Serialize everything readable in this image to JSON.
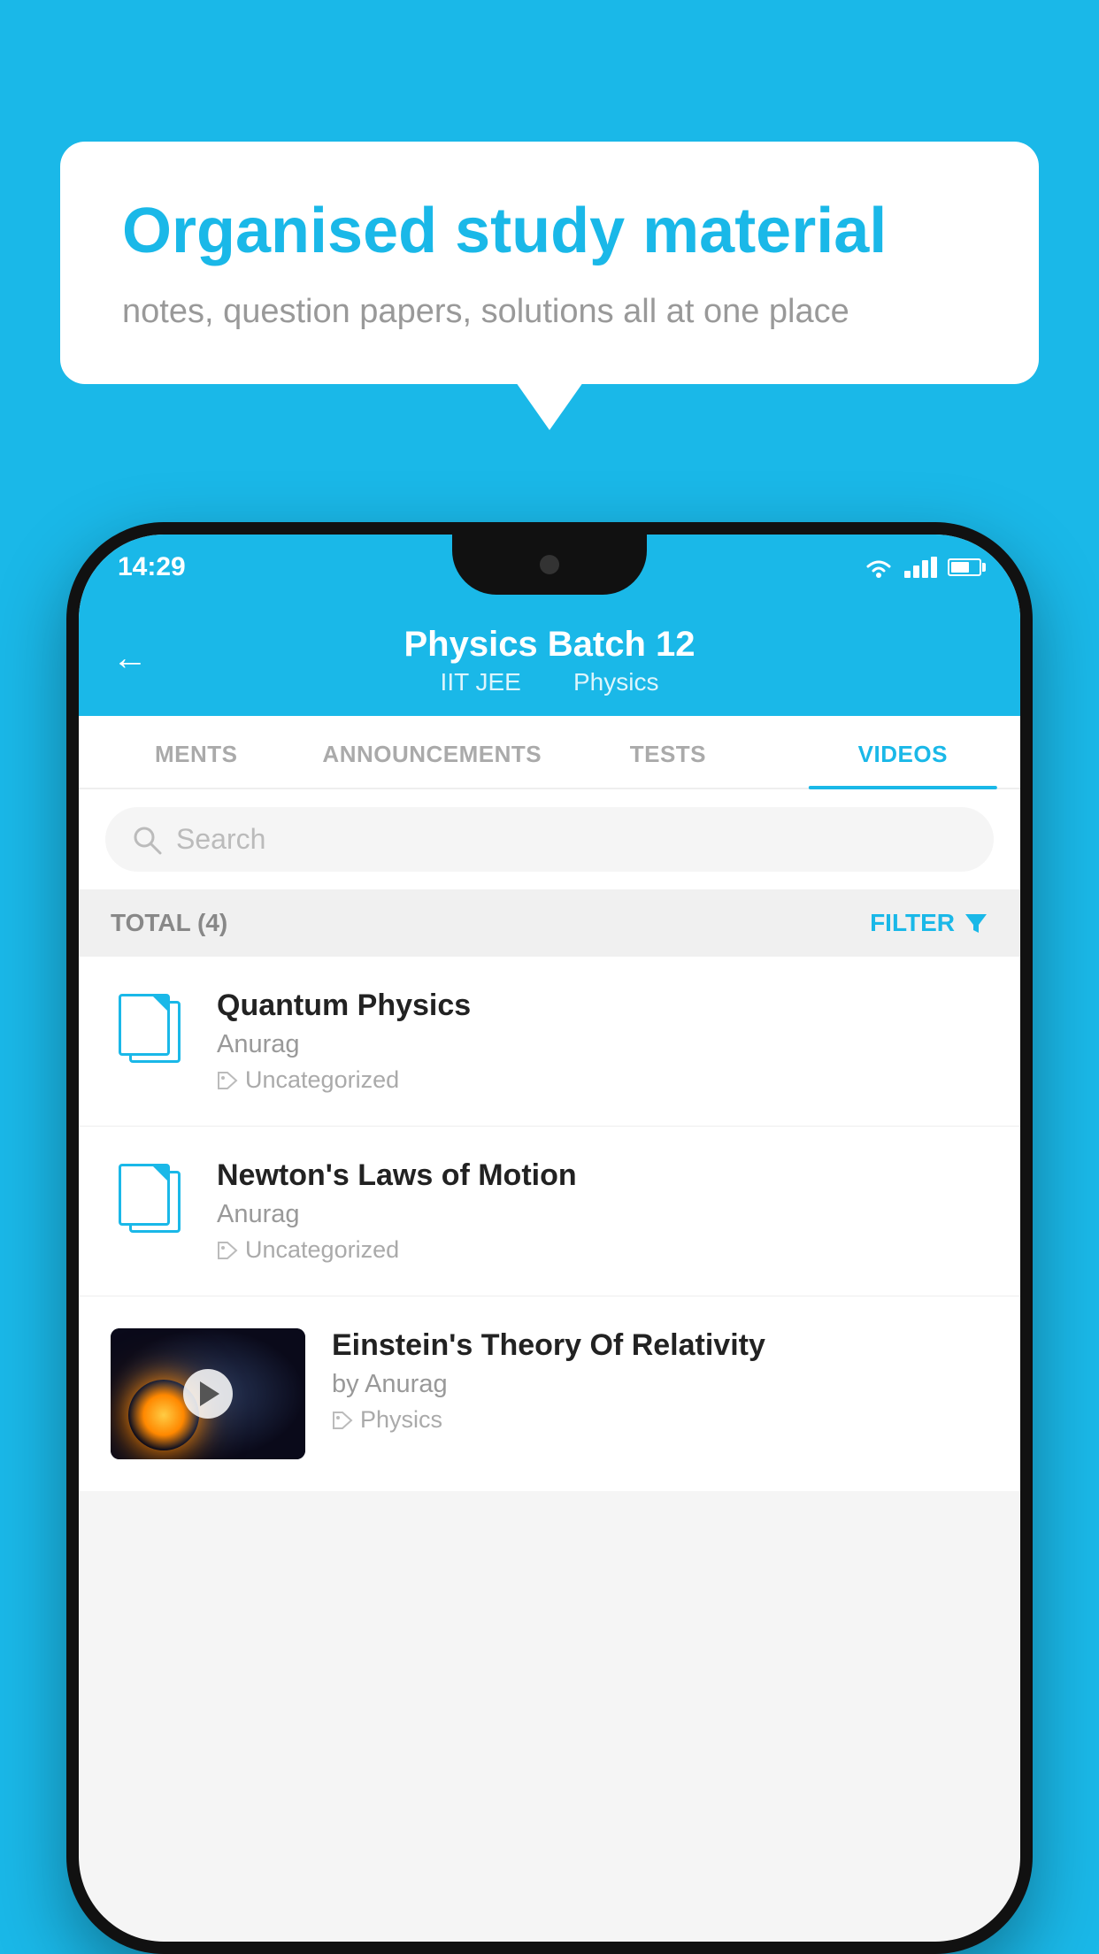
{
  "page": {
    "bg_color": "#1ab8e8"
  },
  "speech_bubble": {
    "title": "Organised study material",
    "subtitle": "notes, question papers, solutions all at one place"
  },
  "status_bar": {
    "time": "14:29"
  },
  "app_header": {
    "title": "Physics Batch 12",
    "tag1": "IIT JEE",
    "tag2": "Physics",
    "back_label": "←"
  },
  "tabs": [
    {
      "label": "MENTS",
      "active": false
    },
    {
      "label": "ANNOUNCEMENTS",
      "active": false
    },
    {
      "label": "TESTS",
      "active": false
    },
    {
      "label": "VIDEOS",
      "active": true
    }
  ],
  "search": {
    "placeholder": "Search"
  },
  "total_bar": {
    "total_label": "TOTAL (4)",
    "filter_label": "FILTER"
  },
  "video_items": [
    {
      "title": "Quantum Physics",
      "author": "Anurag",
      "tag": "Uncategorized",
      "has_thumb": false
    },
    {
      "title": "Newton's Laws of Motion",
      "author": "Anurag",
      "tag": "Uncategorized",
      "has_thumb": false
    },
    {
      "title": "Einstein's Theory Of Relativity",
      "author": "by Anurag",
      "tag": "Physics",
      "has_thumb": true
    }
  ]
}
